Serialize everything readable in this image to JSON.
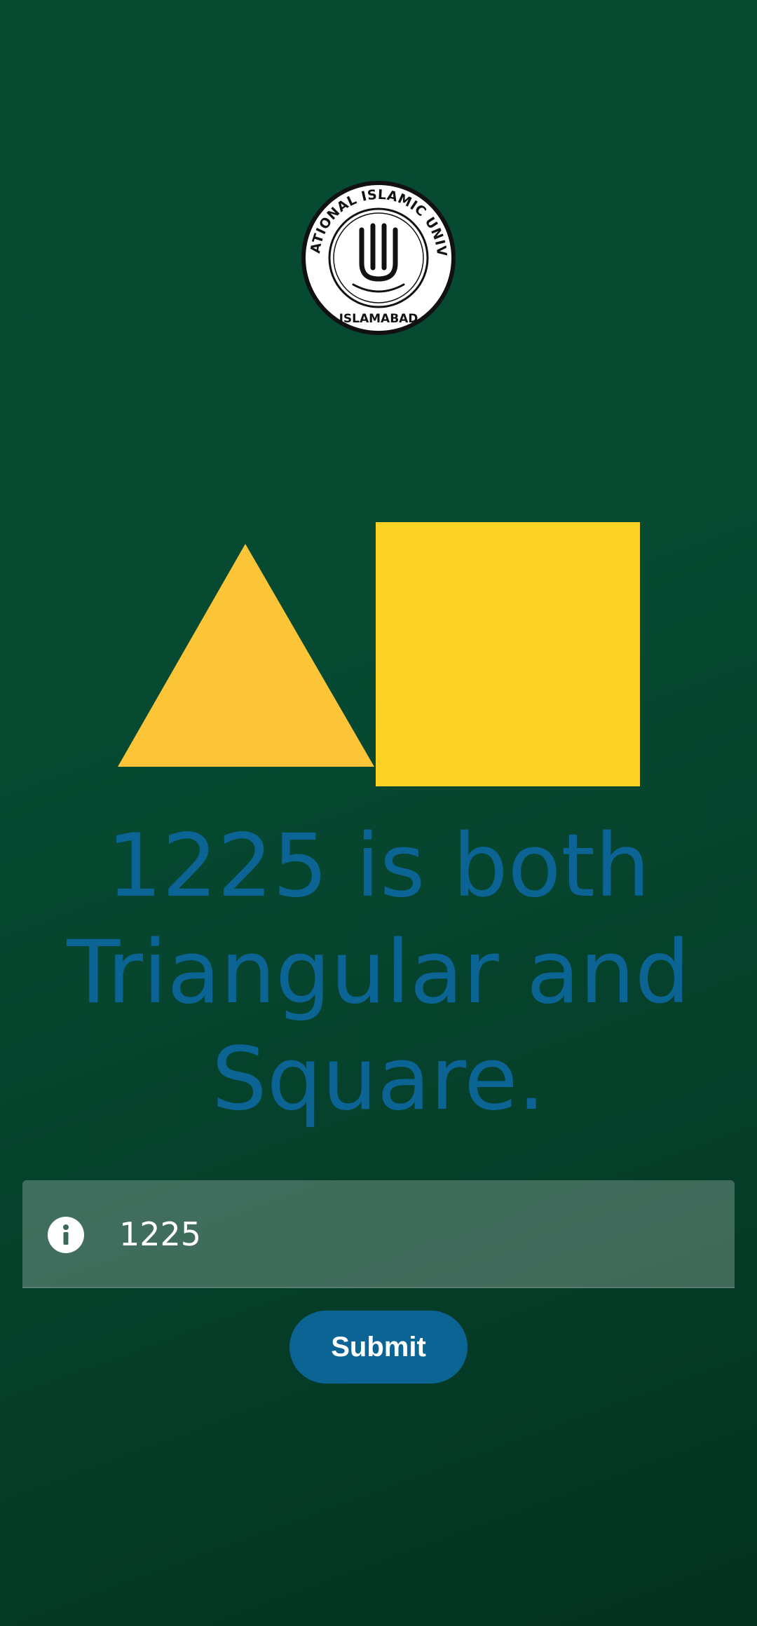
{
  "logo": {
    "top_text": "INTERNATIONAL ISLAMIC UNIVERSITY",
    "bottom_text": "ISLAMABAD",
    "icon": "university-seal-icon"
  },
  "illustration": {
    "triangle_color": "#fcc537",
    "square_color": "#fdd226"
  },
  "message": {
    "text": "1225 is both Triangular and Square."
  },
  "answer_field": {
    "value": "1225",
    "icon": "info-icon"
  },
  "submit": {
    "label": "Submit"
  },
  "colors": {
    "background": "#064a32",
    "accent": "#0b6494",
    "message_text": "#0b6494"
  }
}
